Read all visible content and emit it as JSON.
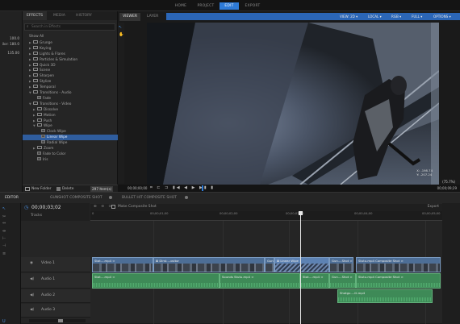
{
  "tabs": [
    "HOME",
    "PROJECT",
    "EDIT",
    "EXPORT"
  ],
  "active_tab": "EDIT",
  "left_values": [
    "100.0",
    "ilor: 180.0",
    "135.00"
  ],
  "effects_panel": {
    "tabs": [
      "EFFECTS",
      "MEDIA",
      "HISTORY"
    ],
    "search_placeholder": "Search in Effects",
    "items": [
      {
        "label": "Show All",
        "indent": 0,
        "type": "plain"
      },
      {
        "label": "Grunge",
        "indent": 1,
        "type": "folder",
        "arrow": "▶"
      },
      {
        "label": "Keying",
        "indent": 1,
        "type": "folder",
        "arrow": "▶"
      },
      {
        "label": "Lights & Flares",
        "indent": 1,
        "type": "folder",
        "arrow": "▶"
      },
      {
        "label": "Particles & Simulation",
        "indent": 1,
        "type": "folder",
        "arrow": "▶"
      },
      {
        "label": "Quick 3D",
        "indent": 1,
        "type": "folder",
        "arrow": "▶"
      },
      {
        "label": "Scene",
        "indent": 1,
        "type": "folder",
        "arrow": "▶"
      },
      {
        "label": "Sharpen",
        "indent": 1,
        "type": "folder",
        "arrow": "▶"
      },
      {
        "label": "Stylize",
        "indent": 1,
        "type": "folder",
        "arrow": "▶"
      },
      {
        "label": "Temporal",
        "indent": 1,
        "type": "folder",
        "arrow": "▶"
      },
      {
        "label": "Transitions - Audio",
        "indent": 1,
        "type": "folder",
        "arrow": "▼"
      },
      {
        "label": "Fade",
        "indent": 2,
        "type": "effect",
        "arrow": ""
      },
      {
        "label": "Transitions - Video",
        "indent": 1,
        "type": "folder",
        "arrow": "▼"
      },
      {
        "label": "Dissolve",
        "indent": 2,
        "type": "folder",
        "arrow": "▶"
      },
      {
        "label": "Motion",
        "indent": 2,
        "type": "folder",
        "arrow": "▶"
      },
      {
        "label": "Push",
        "indent": 2,
        "type": "folder",
        "arrow": "▶"
      },
      {
        "label": "Wipe",
        "indent": 2,
        "type": "folder",
        "arrow": "▼"
      },
      {
        "label": "Clock Wipe",
        "indent": 3,
        "type": "effect",
        "arrow": ""
      },
      {
        "label": "Linear Wipe",
        "indent": 3,
        "type": "effect",
        "arrow": "",
        "selected": true
      },
      {
        "label": "Radial Wipe",
        "indent": 3,
        "type": "effect",
        "arrow": ""
      },
      {
        "label": "Zoom",
        "indent": 2,
        "type": "folder",
        "arrow": "▶"
      },
      {
        "label": "Fade to Color",
        "indent": 2,
        "type": "effect",
        "arrow": ""
      },
      {
        "label": "Iris",
        "indent": 2,
        "type": "effect",
        "arrow": ""
      }
    ],
    "new_folder": "New Folder",
    "delete": "Delete",
    "count": "297 Item(s)"
  },
  "viewer": {
    "tabs": [
      "VIEWER",
      "LAYER"
    ],
    "options": [
      "VIEW: 2D ▾",
      "LOCAL ▾",
      "RGB ▾",
      "FULL ▾",
      "OPTIONS ▾"
    ],
    "coords": "X: -198.74\nY: -207.24",
    "zoom": "(75.7%)",
    "time_start": "00;00;00;00",
    "time_end": "00;00;09;29"
  },
  "editor": {
    "tabs": [
      "EDITOR",
      "GUNSHOT COMPOSITE SHOT",
      "BULLET HIT COMPOSITE SHOT"
    ],
    "timecode": "00;00;03;02",
    "tracks_label": "Tracks",
    "composite_label": "Make Composite Shot",
    "export_label": "Export",
    "ruler_marks": [
      "0",
      "00;00;01;00",
      "00;00;02;00",
      "00;00;03;00",
      "00;00;04;00",
      "00;00;05;00"
    ],
    "tracks": [
      {
        "name": "Video 1",
        "kind": "video"
      },
      {
        "name": "Audio 1",
        "kind": "audio"
      },
      {
        "name": "Audio 2",
        "kind": "audio"
      },
      {
        "name": "Audio 3",
        "kind": "audio"
      }
    ],
    "video_clips": [
      {
        "label": "Stat....mp4 ∞"
      },
      {
        "label": "⊠ Dirst....ositor"
      },
      {
        "label": "Gun"
      },
      {
        "label": "⊠ Linear Wipe"
      },
      {
        "label": "Gun....Shot ∞"
      },
      {
        "label": "Stutu.mp4 Composite Shot ∞"
      }
    ],
    "audio1_clips": [
      {
        "label": "Stat....mp4 ∞"
      },
      {
        "label": "Sounds Stutu.mp4 ∞"
      },
      {
        "label": "Stat....mp4 ∞"
      },
      {
        "label": "Gun....Shot ∞"
      },
      {
        "label": "Stutu.mp4 Composite Shot ∞"
      }
    ],
    "audio2_clips": [
      {
        "label": "Shotgu....ili.mp4"
      }
    ]
  }
}
